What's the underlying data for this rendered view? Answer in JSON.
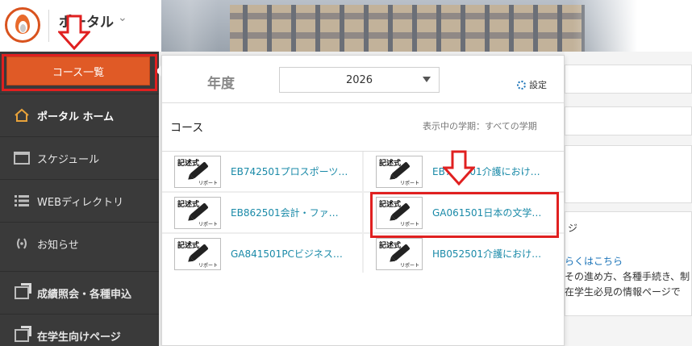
{
  "header": {
    "title": "ポータル",
    "chevron": "⌄"
  },
  "sidebar": {
    "course_button": "コース一覧",
    "items": [
      {
        "label": "ポータル ホーム",
        "icon": "home-icon",
        "active": true
      },
      {
        "label": "スケジュール",
        "icon": "calendar-icon"
      },
      {
        "label": "WEBディレクトリ",
        "icon": "list-icon"
      },
      {
        "label": "お知らせ",
        "icon": "broadcast-icon"
      },
      {
        "label": "成績照会・各種申込",
        "icon": "external-link-icon"
      },
      {
        "label": "在学生向けページ",
        "icon": "external-link-icon"
      }
    ]
  },
  "popup": {
    "year_label": "年度",
    "year_value": "2026",
    "settings_label": "設定",
    "course_header": "コース",
    "term_info": "表示中の学期：すべての学期",
    "thumbnail_label": "記述式",
    "thumbnail_sub": "リポート",
    "courses": [
      {
        "name": "EB742501プロスポーツ…"
      },
      {
        "name": "EB792501介護におけ…"
      },
      {
        "name": "EB862501会計・ファ…"
      },
      {
        "name": "GA061501日本の文学…"
      },
      {
        "name": "GA841501PCビジネス…"
      },
      {
        "name": "HB052501介護におけ…"
      }
    ]
  },
  "background": {
    "partial_text_1": "ジ",
    "partial_link": "らくはこちら",
    "partial_text_2": "その進め方、各種手続き、制",
    "partial_text_3": "在学生必見の情報ページで"
  },
  "colors": {
    "accent": "#e05a26",
    "sidebar_bg": "#3a3a3a",
    "link": "#1a8aa8",
    "annotation": "#e02020"
  }
}
